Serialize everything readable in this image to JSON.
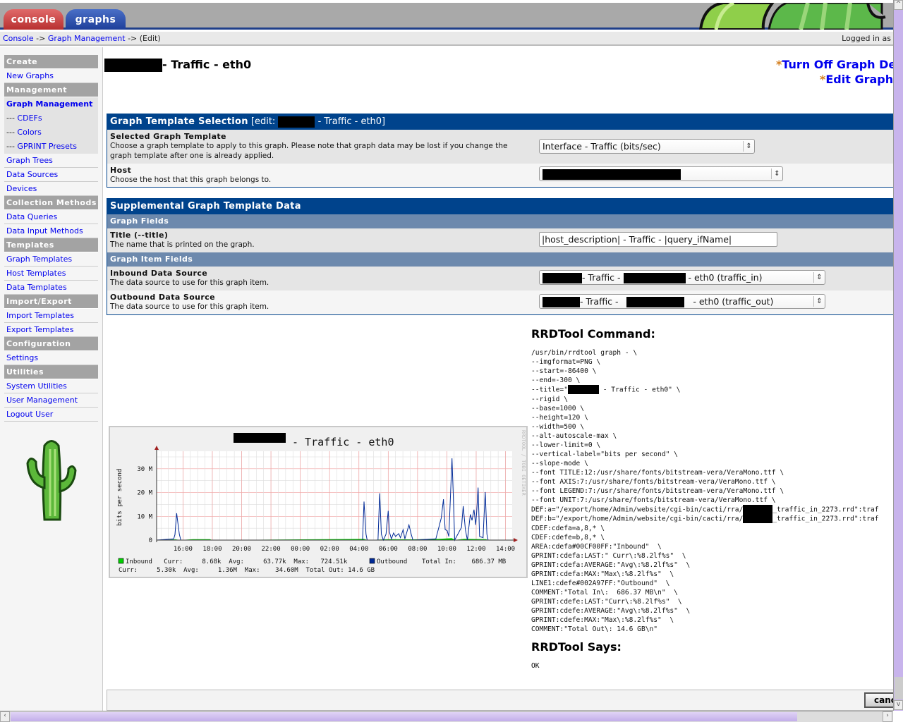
{
  "tabs": [
    {
      "label": "console",
      "color": "#c03a3a"
    },
    {
      "label": "graphs",
      "color": "#2a4ea8"
    }
  ],
  "breadcrumb": {
    "items": [
      "Console",
      "Graph Management"
    ],
    "separator": "->",
    "current": "(Edit)",
    "logged_in": "Logged in as"
  },
  "sidebar": {
    "items": [
      {
        "type": "h",
        "label": "Create"
      },
      {
        "type": "l",
        "label": "New Graphs"
      },
      {
        "type": "h",
        "label": "Management"
      },
      {
        "type": "a",
        "label": "Graph Management"
      },
      {
        "type": "s",
        "label": "CDEFs"
      },
      {
        "type": "s",
        "label": "Colors"
      },
      {
        "type": "s",
        "label": "GPRINT Presets"
      },
      {
        "type": "l",
        "label": "Graph Trees"
      },
      {
        "type": "l",
        "label": "Data Sources"
      },
      {
        "type": "l",
        "label": "Devices"
      },
      {
        "type": "h",
        "label": "Collection Methods"
      },
      {
        "type": "l",
        "label": "Data Queries"
      },
      {
        "type": "l",
        "label": "Data Input Methods"
      },
      {
        "type": "h",
        "label": "Templates"
      },
      {
        "type": "l",
        "label": "Graph Templates"
      },
      {
        "type": "l",
        "label": "Host Templates"
      },
      {
        "type": "l",
        "label": "Data Templates"
      },
      {
        "type": "h",
        "label": "Import/Export"
      },
      {
        "type": "l",
        "label": "Import Templates"
      },
      {
        "type": "l",
        "label": "Export Templates"
      },
      {
        "type": "h",
        "label": "Configuration"
      },
      {
        "type": "l",
        "label": "Settings"
      },
      {
        "type": "h",
        "label": "Utilities"
      },
      {
        "type": "l",
        "label": "System Utilities"
      },
      {
        "type": "l",
        "label": "User Management"
      },
      {
        "type": "l",
        "label": "Logout User"
      }
    ],
    "sub_prefix": "---"
  },
  "page": {
    "title_suffix": "- Traffic - eth0",
    "links": {
      "debug": "Turn Off Graph Debug Mode",
      "edit": "Edit Graph Template"
    },
    "star": "*"
  },
  "template_box": {
    "header": "Graph Template Selection",
    "edit_prefix": "[edit:",
    "edit_suffix": "- Traffic - eth0]",
    "selected_template": {
      "label": "Selected Graph Template",
      "desc": "Choose a graph template to apply to this graph. Please note that graph data may be lost if you change the graph template after one is already applied.",
      "value": "Interface - Traffic (bits/sec)"
    },
    "host": {
      "label": "Host",
      "desc": "Choose the host that this graph belongs to."
    }
  },
  "supp_box": {
    "header": "Supplemental Graph Template Data",
    "graph_fields": "Graph Fields",
    "item_fields": "Graph Item Fields",
    "title": {
      "label": "Title (--title)",
      "desc": "The name that is printed on the graph.",
      "value": "|host_description| - Traffic - |query_ifName|"
    },
    "inbound": {
      "label": "Inbound Data Source",
      "desc": "The data source to use for this graph item.",
      "mid": "- Traffic -",
      "suffix": "- eth0 (traffic_in)"
    },
    "outbound": {
      "label": "Outbound Data Source",
      "desc": "The data source to use for this graph item.",
      "mid": "- Traffic -",
      "suffix": "- eth0 (traffic_out)"
    }
  },
  "rrd": {
    "command_title": "RRDTool Command:",
    "says_title": "RRDTool Says:",
    "says": "OK",
    "lines": [
      [
        "/usr/bin/rrdtool graph - \\"
      ],
      [
        "--imgformat=PNG \\"
      ],
      [
        "--start=-86400 \\"
      ],
      [
        "--end=-300 \\"
      ],
      [
        "--title=\"",
        null,
        " - Traffic - eth0\" \\"
      ],
      [
        "--rigid \\"
      ],
      [
        "--base=1000 \\"
      ],
      [
        "--height=120 \\"
      ],
      [
        "--width=500 \\"
      ],
      [
        "--alt-autoscale-max \\"
      ],
      [
        "--lower-limit=0 \\"
      ],
      [
        "--vertical-label=\"bits per second\" \\"
      ],
      [
        "--slope-mode \\"
      ],
      [
        "--font TITLE:12:/usr/share/fonts/bitstream-vera/VeraMono.ttf \\"
      ],
      [
        "--font AXIS:7:/usr/share/fonts/bitstream-vera/VeraMono.ttf \\"
      ],
      [
        "--font LEGEND:7:/usr/share/fonts/bitstream-vera/VeraMono.ttf \\"
      ],
      [
        "--font UNIT:7:/usr/share/fonts/bitstream-vera/VeraMono.ttf \\"
      ],
      [
        "DEF:a=\"/export/home/Admin/website/cgi-bin/cacti/rra/",
        null,
        "_traffic_in_2273.rrd\":traf"
      ],
      [
        "DEF:b=\"/export/home/Admin/website/cgi-bin/cacti/rra/",
        null,
        "_traffic_in_2273.rrd\":traf"
      ],
      [
        "CDEF:cdefa=a,8,* \\"
      ],
      [
        "CDEF:cdefe=b,8,* \\"
      ],
      [
        "AREA:cdefa#00CF00FF:\"Inbound\"  \\"
      ],
      [
        "GPRINT:cdefa:LAST:\" Curr\\:%8.2lf%s\"  \\"
      ],
      [
        "GPRINT:cdefa:AVERAGE:\"Avg\\:%8.2lf%s\"  \\"
      ],
      [
        "GPRINT:cdefa:MAX:\"Max\\:%8.2lf%s\"  \\"
      ],
      [
        "LINE1:cdefe#002A97FF:\"Outbound\"  \\"
      ],
      [
        "COMMENT:\"Total In\\:  686.37 MB\\n\"  \\"
      ],
      [
        "GPRINT:cdefe:LAST:\"Curr\\:%8.2lf%s\"  \\"
      ],
      [
        "GPRINT:cdefe:AVERAGE:\"Avg\\:%8.2lf%s\"  \\"
      ],
      [
        "GPRINT:cdefe:MAX:\"Max\\:%8.2lf%s\"  \\"
      ],
      [
        "COMMENT:\"Total Out\\: 14.6 GB\\n\""
      ]
    ]
  },
  "graph": {
    "title_suffix": "- Traffic - eth0",
    "watermark": "RRDTOOL / TOBI OETIKER"
  },
  "chart_data": {
    "type": "area",
    "title": "- Traffic - eth0",
    "ylabel": "bits per second",
    "ylim": [
      0,
      35
    ],
    "y_unit": "M",
    "yticks": [
      "0",
      "10 M",
      "20 M",
      "30 M"
    ],
    "xticks": [
      "16:00",
      "18:00",
      "20:00",
      "22:00",
      "00:00",
      "02:00",
      "04:00",
      "06:00",
      "08:00",
      "10:00",
      "12:00",
      "14:00"
    ],
    "xlim": [
      "14:12",
      "14:10"
    ],
    "grid": true,
    "series": [
      {
        "name": "Inbound",
        "color": "#00CF00",
        "kind": "area",
        "points": [
          [
            "14:12",
            0
          ],
          [
            "15:30",
            0.3
          ],
          [
            "15:50",
            0
          ],
          [
            "16:40",
            0.4
          ],
          [
            "17:50",
            0.4
          ],
          [
            "18:00",
            0
          ],
          [
            "04:20",
            0.5
          ],
          [
            "04:35",
            0
          ],
          [
            "06:00",
            0.4
          ],
          [
            "07:40",
            0.3
          ],
          [
            "09:30",
            0.5
          ],
          [
            "10:20",
            0.8
          ],
          [
            "10:35",
            0.1
          ],
          [
            "11:10",
            0.5
          ],
          [
            "12:40",
            0.4
          ],
          [
            "12:50",
            0
          ],
          [
            "14:10",
            0
          ]
        ]
      },
      {
        "name": "Outbound",
        "color": "#002A97",
        "kind": "line",
        "points": [
          [
            "14:12",
            0
          ],
          [
            "15:22",
            0.5
          ],
          [
            "15:27",
            2.3
          ],
          [
            "15:34",
            11.3
          ],
          [
            "15:40",
            6.4
          ],
          [
            "15:45",
            2.5
          ],
          [
            "15:51",
            0
          ],
          [
            "04:15",
            0
          ],
          [
            "04:21",
            16.2
          ],
          [
            "04:29",
            2.5
          ],
          [
            "04:34",
            0
          ],
          [
            "05:18",
            0
          ],
          [
            "05:25",
            19.7
          ],
          [
            "05:32",
            2.5
          ],
          [
            "05:40",
            0
          ],
          [
            "05:51",
            2.5
          ],
          [
            "06:00",
            12.3
          ],
          [
            "06:05",
            3.4
          ],
          [
            "06:13",
            0.5
          ],
          [
            "06:22",
            3.0
          ],
          [
            "06:30",
            1.5
          ],
          [
            "06:43",
            2.7
          ],
          [
            "06:50",
            1.0
          ],
          [
            "07:01",
            4.4
          ],
          [
            "07:08",
            0.5
          ],
          [
            "07:25",
            6.4
          ],
          [
            "07:34",
            2.5
          ],
          [
            "07:41",
            0
          ],
          [
            "09:15",
            0.5
          ],
          [
            "09:37",
            9.3
          ],
          [
            "09:46",
            17.2
          ],
          [
            "09:53",
            4.4
          ],
          [
            "10:01",
            4.0
          ],
          [
            "10:08",
            1.5
          ],
          [
            "10:21",
            34.4
          ],
          [
            "10:26",
            20
          ],
          [
            "10:32",
            0
          ],
          [
            "11:00",
            5.4
          ],
          [
            "11:07",
            14.3
          ],
          [
            "11:16",
            4.4
          ],
          [
            "11:24",
            0
          ],
          [
            "11:36",
            10.8
          ],
          [
            "11:43",
            8.3
          ],
          [
            "11:51",
            12.8
          ],
          [
            "11:58",
            6.4
          ],
          [
            "12:02",
            11.8
          ],
          [
            "12:08",
            22.1
          ],
          [
            "12:14",
            1.5
          ],
          [
            "12:28",
            1.0
          ],
          [
            "12:37",
            20.2
          ],
          [
            "12:44",
            2.5
          ],
          [
            "12:49",
            0
          ],
          [
            "14:10",
            0
          ]
        ]
      }
    ],
    "legend": {
      "line1": "Inbound   Curr:     8.68k  Avg:     63.77k  Max:   724.51k",
      "outbound": "Outbound",
      "total_in": "Total In:    686.37 MB",
      "line2": "Curr:     5.30k  Avg:     1.36M  Max:    34.60M  Total Out: 14.6 GB"
    }
  },
  "footer": {
    "cancel": "cancel"
  }
}
